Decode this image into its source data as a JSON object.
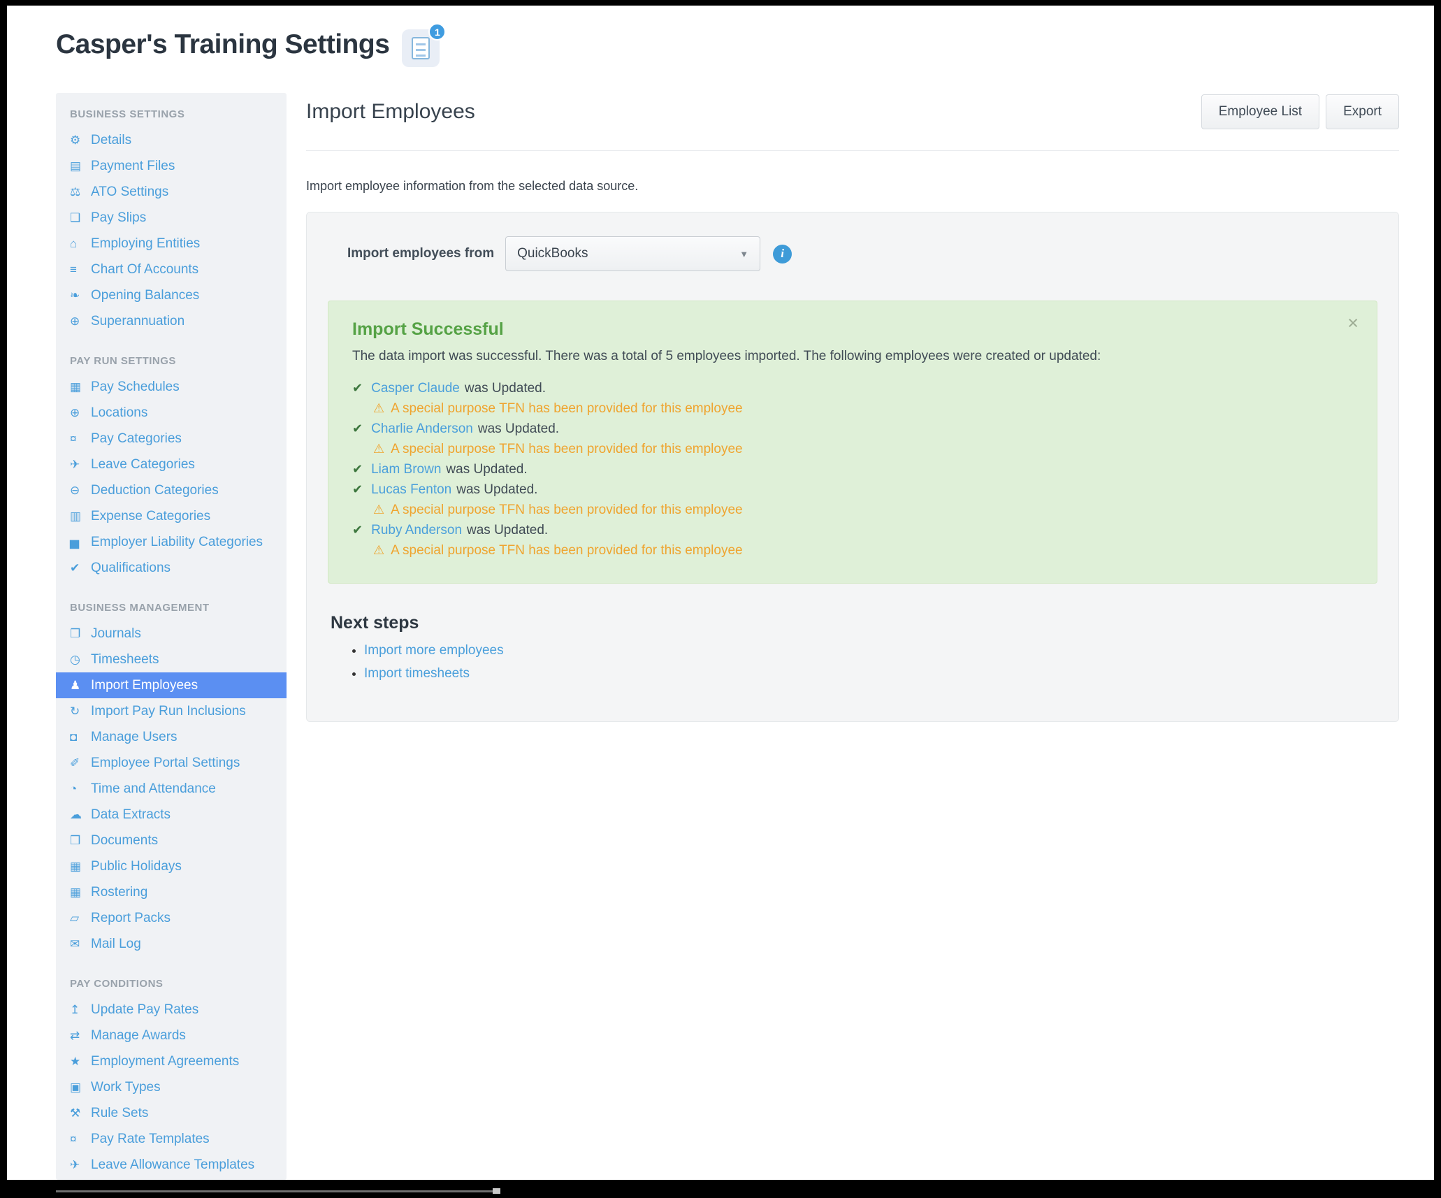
{
  "page": {
    "title": "Casper's Training Settings",
    "title_badge_count": "1"
  },
  "icon_glyphs": {
    "gear": "⚙",
    "save": "▤",
    "scales": "⚖",
    "file": "❑",
    "bank": "⌂",
    "list": "≡",
    "leaf": "❧",
    "globe": "⊕",
    "calendar": "▦",
    "money": "¤",
    "plane": "✈",
    "minus-circle": "⊖",
    "card": "▥",
    "bar-chart": "▅",
    "check": "✔",
    "book": "❐",
    "clock": "◷",
    "people": "♟",
    "refresh": "↻",
    "lock": "◘",
    "wand": "✐",
    "watch": "◔",
    "cloud": "☁",
    "folder": "❒",
    "folder-open": "▱",
    "envelope": "✉",
    "money-up": "↥",
    "swap": "⇄",
    "star": "★",
    "briefcase": "▣",
    "tools": "⚒",
    "chevron-down": "▼",
    "info": "i",
    "close": "×",
    "warning": "⚠"
  },
  "sidebar": {
    "sections": [
      {
        "header": "BUSINESS SETTINGS",
        "items": [
          {
            "label": "Details",
            "icon": "gear"
          },
          {
            "label": "Payment Files",
            "icon": "save"
          },
          {
            "label": "ATO Settings",
            "icon": "scales"
          },
          {
            "label": "Pay Slips",
            "icon": "file"
          },
          {
            "label": "Employing Entities",
            "icon": "bank"
          },
          {
            "label": "Chart Of Accounts",
            "icon": "list"
          },
          {
            "label": "Opening Balances",
            "icon": "leaf"
          },
          {
            "label": "Superannuation",
            "icon": "globe"
          }
        ]
      },
      {
        "header": "PAY RUN SETTINGS",
        "items": [
          {
            "label": "Pay Schedules",
            "icon": "calendar"
          },
          {
            "label": "Locations",
            "icon": "globe"
          },
          {
            "label": "Pay Categories",
            "icon": "money"
          },
          {
            "label": "Leave Categories",
            "icon": "plane"
          },
          {
            "label": "Deduction Categories",
            "icon": "minus-circle"
          },
          {
            "label": "Expense Categories",
            "icon": "card"
          },
          {
            "label": "Employer Liability Categories",
            "icon": "bar-chart"
          },
          {
            "label": "Qualifications",
            "icon": "check"
          }
        ]
      },
      {
        "header": "BUSINESS MANAGEMENT",
        "items": [
          {
            "label": "Journals",
            "icon": "book"
          },
          {
            "label": "Timesheets",
            "icon": "clock"
          },
          {
            "label": "Import Employees",
            "icon": "people",
            "selected": true
          },
          {
            "label": "Import Pay Run Inclusions",
            "icon": "refresh"
          },
          {
            "label": "Manage Users",
            "icon": "lock"
          },
          {
            "label": "Employee Portal Settings",
            "icon": "wand"
          },
          {
            "label": "Time and Attendance",
            "icon": "watch"
          },
          {
            "label": "Data Extracts",
            "icon": "cloud"
          },
          {
            "label": "Documents",
            "icon": "folder"
          },
          {
            "label": "Public Holidays",
            "icon": "calendar"
          },
          {
            "label": "Rostering",
            "icon": "calendar"
          },
          {
            "label": "Report Packs",
            "icon": "folder-open"
          },
          {
            "label": "Mail Log",
            "icon": "envelope"
          }
        ]
      },
      {
        "header": "PAY CONDITIONS",
        "items": [
          {
            "label": "Update Pay Rates",
            "icon": "money-up"
          },
          {
            "label": "Manage Awards",
            "icon": "swap"
          },
          {
            "label": "Employment Agreements",
            "icon": "star"
          },
          {
            "label": "Work Types",
            "icon": "briefcase"
          },
          {
            "label": "Rule Sets",
            "icon": "tools"
          },
          {
            "label": "Pay Rate Templates",
            "icon": "money"
          },
          {
            "label": "Leave Allowance Templates",
            "icon": "plane"
          }
        ]
      }
    ]
  },
  "main": {
    "heading": "Import Employees",
    "buttons": {
      "employee_list": "Employee List",
      "export": "Export"
    },
    "intro": "Import employee information from the selected data source.",
    "import_form": {
      "label": "Import employees from",
      "selected_source": "QuickBooks"
    },
    "success": {
      "title": "Import Successful",
      "message": "The data import was successful. There was a total of 5 employees imported. The following employees were created or updated:",
      "employees": [
        {
          "name": "Casper Claude",
          "status": "was Updated.",
          "warning": "A special purpose TFN has been provided for this employee"
        },
        {
          "name": "Charlie Anderson",
          "status": "was Updated.",
          "warning": "A special purpose TFN has been provided for this employee"
        },
        {
          "name": "Liam Brown",
          "status": "was Updated."
        },
        {
          "name": "Lucas Fenton",
          "status": "was Updated.",
          "warning": "A special purpose TFN has been provided for this employee"
        },
        {
          "name": "Ruby Anderson",
          "status": "was Updated.",
          "warning": "A special purpose TFN has been provided for this employee"
        }
      ]
    },
    "next_steps": {
      "heading": "Next steps",
      "links": [
        "Import more employees",
        "Import timesheets"
      ]
    }
  },
  "colors": {
    "accent_blue": "#4a9edb",
    "selected_blue": "#5b8ff2",
    "success_bg": "#dff0d8",
    "success_title_green": "#55a245",
    "warning_orange": "#efa42f",
    "sidebar_bg": "#f0f2f5",
    "panel_bg": "#f4f5f6"
  }
}
